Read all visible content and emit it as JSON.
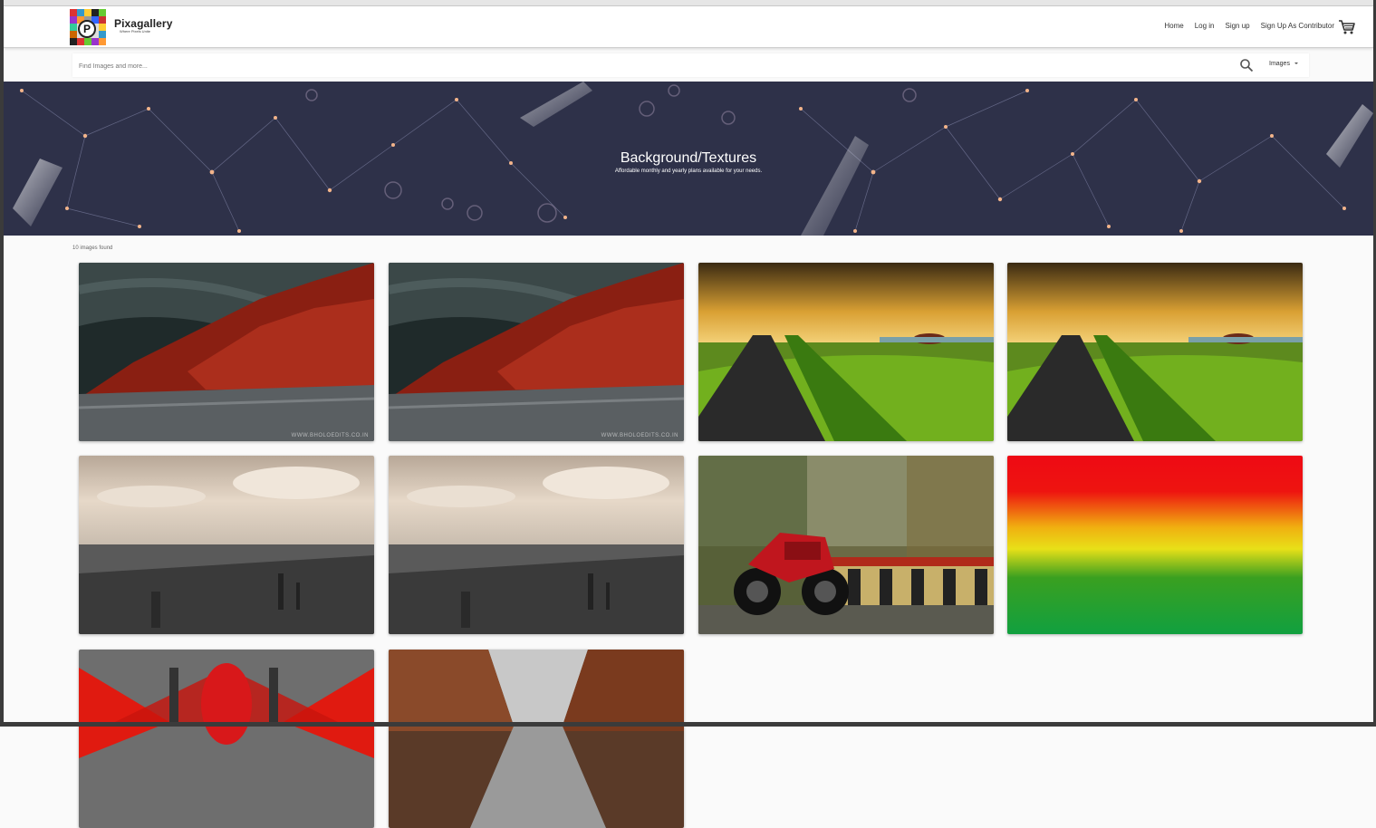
{
  "navbar": {
    "brand": "Pixagallery",
    "tagline": "Where Pixels Unite",
    "links": [
      "Home",
      "Log in",
      "Sign up",
      "Sign Up As Contributor"
    ],
    "cart_icon": "cart-icon"
  },
  "search": {
    "placeholder": "Find Images and more...",
    "value": "",
    "type_selected": "Images",
    "icon": "search-icon"
  },
  "hero": {
    "title": "Background/Textures",
    "subtitle": "Affordable monthly and yearly plans available for your needs."
  },
  "results": {
    "count_text": "10 images found"
  },
  "images": [
    {
      "subject": "autumn red trees road under stormy sky",
      "watermark": "WWW.BHOLOEDITS.CO.IN"
    },
    {
      "subject": "autumn red trees road under stormy sky",
      "watermark": "WWW.BHOLOEDITS.CO.IN"
    },
    {
      "subject": "road through green grass at sunset",
      "watermark": ""
    },
    {
      "subject": "road through green grass at sunset",
      "watermark": ""
    },
    {
      "subject": "hazy city skyline under cloudy sky",
      "watermark": ""
    },
    {
      "subject": "hazy city skyline under cloudy sky",
      "watermark": ""
    },
    {
      "subject": "red motorcycle by striped road barrier",
      "watermark": ""
    },
    {
      "subject": "red yellow green gradient texture",
      "watermark": ""
    },
    {
      "subject": "red light rays with figure",
      "watermark": ""
    },
    {
      "subject": "autumn tree lined path",
      "watermark": ""
    }
  ],
  "colors": {
    "hero_bg": "#2e3149",
    "page_bg": "#fafafa",
    "navbar_bg": "#ffffff"
  }
}
